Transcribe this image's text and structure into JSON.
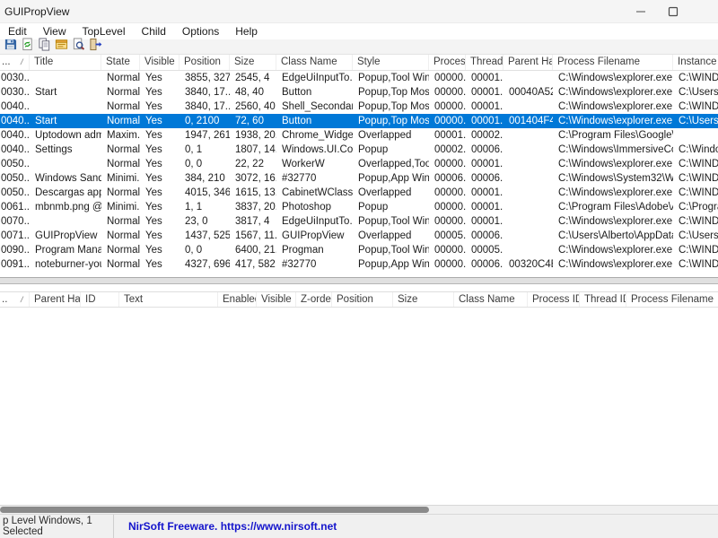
{
  "window": {
    "title": "GUIPropView"
  },
  "menu": {
    "items": [
      "Edit",
      "View",
      "TopLevel",
      "Child",
      "Options",
      "Help"
    ]
  },
  "toolbar": {
    "icons": [
      "save-icon",
      "refresh-icon",
      "copy-icon",
      "properties-icon",
      "find-icon",
      "exit-icon"
    ]
  },
  "top_pane": {
    "columns": [
      "...",
      "Title",
      "State",
      "Visible",
      "Position",
      "Size",
      "Class Name",
      "Style",
      "Proces...",
      "Thread...",
      "Parent Ha...",
      "Process Filename",
      "Instance F..."
    ],
    "widths": [
      33,
      80,
      43,
      44,
      56,
      52,
      85,
      85,
      41,
      42,
      55,
      134,
      130
    ],
    "sort_column": 0,
    "selected_row": 3,
    "rows": [
      [
        "0030...",
        "",
        "Normal",
        "Yes",
        "3855, 327",
        "2545, 4",
        "EdgeUiInputTo...",
        "Popup,Tool Win...",
        "00000...",
        "00001...",
        "",
        "C:\\Windows\\explorer.exe",
        "C:\\WINDO..."
      ],
      [
        "0030...",
        "Start",
        "Normal",
        "Yes",
        "3840, 17...",
        "48, 40",
        "Button",
        "Popup,Top Mos...",
        "00000...",
        "00001...",
        "00040A52",
        "C:\\Windows\\explorer.exe",
        "C:\\Users\\..."
      ],
      [
        "0040...",
        "",
        "Normal",
        "Yes",
        "3840, 17...",
        "2560, 40",
        "Shell_Secondar...",
        "Popup,Top Mos...",
        "00000...",
        "00001...",
        "",
        "C:\\Windows\\explorer.exe",
        "C:\\WINDO..."
      ],
      [
        "0040...",
        "Start",
        "Normal",
        "Yes",
        "0, 2100",
        "72, 60",
        "Button",
        "Popup,Top Mos...",
        "00000...",
        "00001...",
        "001404F4",
        "C:\\Windows\\explorer.exe",
        "C:\\Users\\..."
      ],
      [
        "0040...",
        "Uptodown adm...",
        "Maxim...",
        "Yes",
        "1947, 261",
        "1938, 20...",
        "Chrome_Widge...",
        "Overlapped",
        "00001...",
        "00002...",
        "",
        "C:\\Program Files\\Google\\Ch...",
        ""
      ],
      [
        "0040...",
        "Settings",
        "Normal",
        "Yes",
        "0, 1",
        "1807, 14...",
        "Windows.UI.Co...",
        "Popup",
        "00002...",
        "00006...",
        "",
        "C:\\Windows\\ImmersiveCont...",
        "C:\\Windo..."
      ],
      [
        "0050...",
        "",
        "Normal",
        "Yes",
        "0, 0",
        "22, 22",
        "WorkerW",
        "Overlapped,Too...",
        "00000...",
        "00001...",
        "",
        "C:\\Windows\\explorer.exe",
        "C:\\WINDO..."
      ],
      [
        "0050...",
        "Windows Sand...",
        "Minimi...",
        "Yes",
        "384, 210",
        "3072, 16...",
        "#32770",
        "Popup,App Win...",
        "00006...",
        "00006...",
        "",
        "C:\\Windows\\System32\\Win...",
        "C:\\WINDO..."
      ],
      [
        "0050...",
        "Descargas apps",
        "Normal",
        "Yes",
        "4015, 346",
        "1615, 13...",
        "CabinetWClass",
        "Overlapped",
        "00000...",
        "00001...",
        "",
        "C:\\Windows\\explorer.exe",
        "C:\\WINDO..."
      ],
      [
        "0061...",
        "mbnmb.png @...",
        "Minimi...",
        "Yes",
        "1, 1",
        "3837, 20...",
        "Photoshop",
        "Popup",
        "00000...",
        "00001...",
        "",
        "C:\\Program Files\\Adobe\\Ad...",
        "C:\\Progra..."
      ],
      [
        "0070...",
        "",
        "Normal",
        "Yes",
        "23, 0",
        "3817, 4",
        "EdgeUiInputTo...",
        "Popup,Tool Win...",
        "00000...",
        "00001...",
        "",
        "C:\\Windows\\explorer.exe",
        "C:\\WINDO..."
      ],
      [
        "0071...",
        "GUIPropView",
        "Normal",
        "Yes",
        "1437, 525",
        "1567, 11...",
        "GUIPropView",
        "Overlapped",
        "00005...",
        "00006...",
        "",
        "C:\\Users\\Alberto\\AppData\\L...",
        "C:\\Users\\..."
      ],
      [
        "0090...",
        "Program Mana...",
        "Normal",
        "Yes",
        "0, 0",
        "6400, 21...",
        "Progman",
        "Popup,Tool Win...",
        "00000...",
        "00005...",
        "",
        "C:\\Windows\\explorer.exe",
        "C:\\WINDO..."
      ],
      [
        "0091...",
        "noteburner-you...",
        "Normal",
        "Yes",
        "4327, 696",
        "417, 582",
        "#32770",
        "Popup,App Win...",
        "00000...",
        "00006...",
        "00320C4E",
        "C:\\Windows\\explorer.exe",
        "C:\\WINDO..."
      ]
    ]
  },
  "bottom_pane": {
    "columns": [
      "..",
      "Parent Ha...",
      "ID",
      "Text",
      "Enabled",
      "Visible",
      "Z-order",
      "Position",
      "Size",
      "Class Name",
      "Process ID",
      "Thread ID",
      "Process Filename"
    ],
    "widths": [
      33,
      57,
      43,
      110,
      43,
      44,
      40,
      68,
      68,
      82,
      58,
      52,
      122
    ],
    "sort_column": 0,
    "rows": []
  },
  "status_bar": {
    "left": "p Level Windows, 1 Selected",
    "right": "NirSoft Freeware. https://www.nirsoft.net"
  },
  "colors": {
    "selection": "#0078d7",
    "selection_text": "#ffffff",
    "link": "#1414cc"
  }
}
